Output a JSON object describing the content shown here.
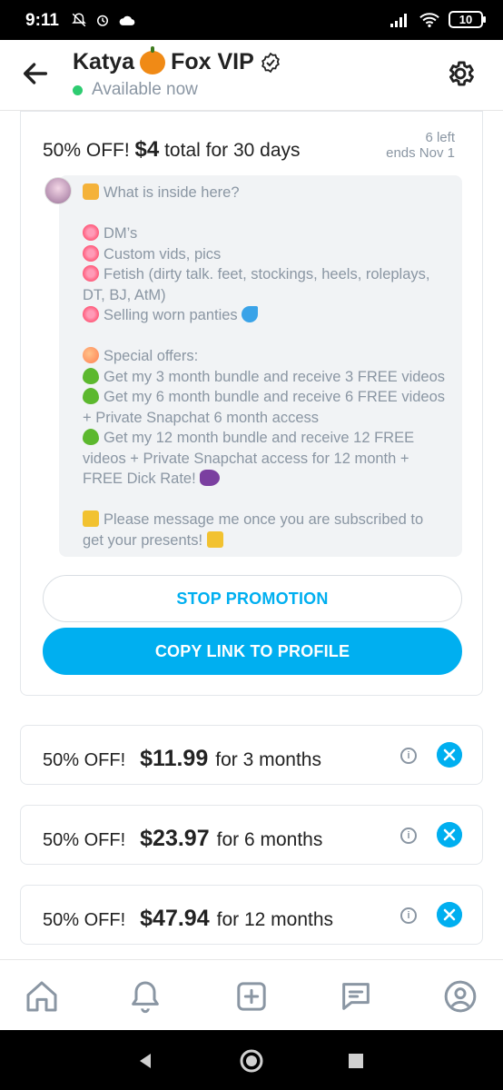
{
  "status_bar": {
    "time": "9:11",
    "battery": "10",
    "left_icons": [
      "notifications-off-icon",
      "alarm-icon",
      "cloud-icon"
    ],
    "right_icons": [
      "signal-icon",
      "wifi-icon",
      "battery-icon"
    ]
  },
  "header": {
    "name_part1": "Katya",
    "name_part2": "Fox VIP",
    "status": "Available now",
    "status_color": "#2ecc71"
  },
  "promo": {
    "discount": "50% OFF!",
    "price": "$4",
    "price_suffix": "total for 30 days",
    "left_count": "6 left",
    "ends": "ends Nov 1",
    "message_lines": [
      "What is inside here?",
      "",
      "DM’s",
      "Custom vids, pics",
      "Fetish (dirty talk. feet, stockings, heels, roleplays,",
      "DT, BJ, AtM)",
      "Selling worn panties",
      "",
      "Special offers:",
      "Get my 3 month bundle and receive 3 FREE videos",
      "Get my 6 month bundle and receive 6 FREE videos",
      "+ Private Snapchat 6 month access",
      "Get my 12 month bundle and receive 12 FREE",
      "videos + Private Snapchat access for 12 month +",
      "FREE Dick Rate!",
      "",
      "Please message me once you are subscribed to",
      "get your presents!"
    ],
    "stop_label": "STOP PROMOTION",
    "copy_label": "COPY LINK TO PROFILE"
  },
  "offers": [
    {
      "discount": "50% OFF!",
      "price": "$11.99",
      "duration": "for 3 months"
    },
    {
      "discount": "50% OFF!",
      "price": "$23.97",
      "duration": "for 6 months"
    },
    {
      "discount": "50% OFF!",
      "price": "$47.94",
      "duration": "for 12 months"
    }
  ],
  "bottom_nav": [
    "home-icon",
    "notifications-icon",
    "add-post-icon",
    "messages-icon",
    "profile-icon"
  ],
  "colors": {
    "accent": "#00aff0",
    "muted": "#8a96a3"
  }
}
